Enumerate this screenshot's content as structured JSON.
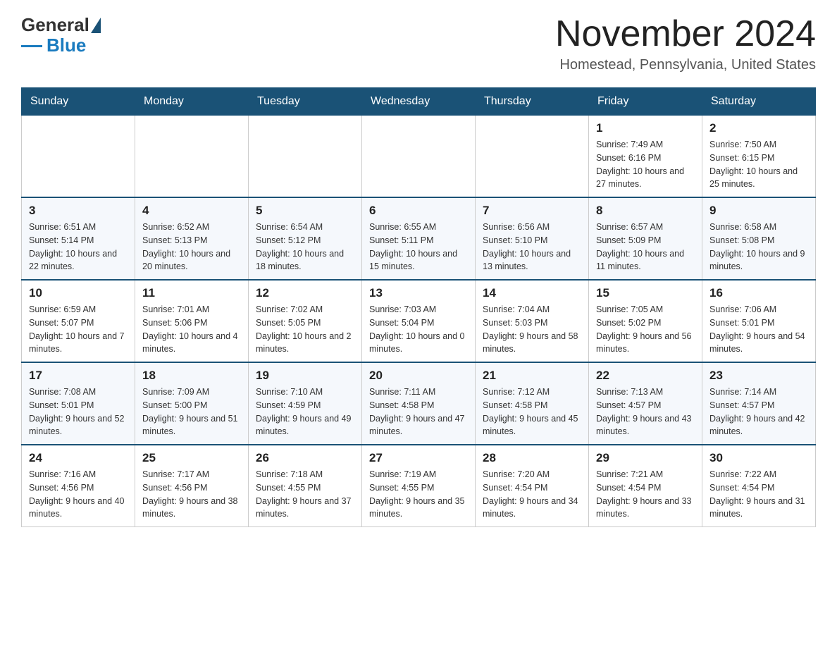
{
  "logo": {
    "general": "General",
    "blue": "Blue"
  },
  "title": "November 2024",
  "subtitle": "Homestead, Pennsylvania, United States",
  "days_of_week": [
    "Sunday",
    "Monday",
    "Tuesday",
    "Wednesday",
    "Thursday",
    "Friday",
    "Saturday"
  ],
  "weeks": [
    [
      {
        "day": "",
        "info": ""
      },
      {
        "day": "",
        "info": ""
      },
      {
        "day": "",
        "info": ""
      },
      {
        "day": "",
        "info": ""
      },
      {
        "day": "",
        "info": ""
      },
      {
        "day": "1",
        "info": "Sunrise: 7:49 AM\nSunset: 6:16 PM\nDaylight: 10 hours and 27 minutes."
      },
      {
        "day": "2",
        "info": "Sunrise: 7:50 AM\nSunset: 6:15 PM\nDaylight: 10 hours and 25 minutes."
      }
    ],
    [
      {
        "day": "3",
        "info": "Sunrise: 6:51 AM\nSunset: 5:14 PM\nDaylight: 10 hours and 22 minutes."
      },
      {
        "day": "4",
        "info": "Sunrise: 6:52 AM\nSunset: 5:13 PM\nDaylight: 10 hours and 20 minutes."
      },
      {
        "day": "5",
        "info": "Sunrise: 6:54 AM\nSunset: 5:12 PM\nDaylight: 10 hours and 18 minutes."
      },
      {
        "day": "6",
        "info": "Sunrise: 6:55 AM\nSunset: 5:11 PM\nDaylight: 10 hours and 15 minutes."
      },
      {
        "day": "7",
        "info": "Sunrise: 6:56 AM\nSunset: 5:10 PM\nDaylight: 10 hours and 13 minutes."
      },
      {
        "day": "8",
        "info": "Sunrise: 6:57 AM\nSunset: 5:09 PM\nDaylight: 10 hours and 11 minutes."
      },
      {
        "day": "9",
        "info": "Sunrise: 6:58 AM\nSunset: 5:08 PM\nDaylight: 10 hours and 9 minutes."
      }
    ],
    [
      {
        "day": "10",
        "info": "Sunrise: 6:59 AM\nSunset: 5:07 PM\nDaylight: 10 hours and 7 minutes."
      },
      {
        "day": "11",
        "info": "Sunrise: 7:01 AM\nSunset: 5:06 PM\nDaylight: 10 hours and 4 minutes."
      },
      {
        "day": "12",
        "info": "Sunrise: 7:02 AM\nSunset: 5:05 PM\nDaylight: 10 hours and 2 minutes."
      },
      {
        "day": "13",
        "info": "Sunrise: 7:03 AM\nSunset: 5:04 PM\nDaylight: 10 hours and 0 minutes."
      },
      {
        "day": "14",
        "info": "Sunrise: 7:04 AM\nSunset: 5:03 PM\nDaylight: 9 hours and 58 minutes."
      },
      {
        "day": "15",
        "info": "Sunrise: 7:05 AM\nSunset: 5:02 PM\nDaylight: 9 hours and 56 minutes."
      },
      {
        "day": "16",
        "info": "Sunrise: 7:06 AM\nSunset: 5:01 PM\nDaylight: 9 hours and 54 minutes."
      }
    ],
    [
      {
        "day": "17",
        "info": "Sunrise: 7:08 AM\nSunset: 5:01 PM\nDaylight: 9 hours and 52 minutes."
      },
      {
        "day": "18",
        "info": "Sunrise: 7:09 AM\nSunset: 5:00 PM\nDaylight: 9 hours and 51 minutes."
      },
      {
        "day": "19",
        "info": "Sunrise: 7:10 AM\nSunset: 4:59 PM\nDaylight: 9 hours and 49 minutes."
      },
      {
        "day": "20",
        "info": "Sunrise: 7:11 AM\nSunset: 4:58 PM\nDaylight: 9 hours and 47 minutes."
      },
      {
        "day": "21",
        "info": "Sunrise: 7:12 AM\nSunset: 4:58 PM\nDaylight: 9 hours and 45 minutes."
      },
      {
        "day": "22",
        "info": "Sunrise: 7:13 AM\nSunset: 4:57 PM\nDaylight: 9 hours and 43 minutes."
      },
      {
        "day": "23",
        "info": "Sunrise: 7:14 AM\nSunset: 4:57 PM\nDaylight: 9 hours and 42 minutes."
      }
    ],
    [
      {
        "day": "24",
        "info": "Sunrise: 7:16 AM\nSunset: 4:56 PM\nDaylight: 9 hours and 40 minutes."
      },
      {
        "day": "25",
        "info": "Sunrise: 7:17 AM\nSunset: 4:56 PM\nDaylight: 9 hours and 38 minutes."
      },
      {
        "day": "26",
        "info": "Sunrise: 7:18 AM\nSunset: 4:55 PM\nDaylight: 9 hours and 37 minutes."
      },
      {
        "day": "27",
        "info": "Sunrise: 7:19 AM\nSunset: 4:55 PM\nDaylight: 9 hours and 35 minutes."
      },
      {
        "day": "28",
        "info": "Sunrise: 7:20 AM\nSunset: 4:54 PM\nDaylight: 9 hours and 34 minutes."
      },
      {
        "day": "29",
        "info": "Sunrise: 7:21 AM\nSunset: 4:54 PM\nDaylight: 9 hours and 33 minutes."
      },
      {
        "day": "30",
        "info": "Sunrise: 7:22 AM\nSunset: 4:54 PM\nDaylight: 9 hours and 31 minutes."
      }
    ]
  ]
}
